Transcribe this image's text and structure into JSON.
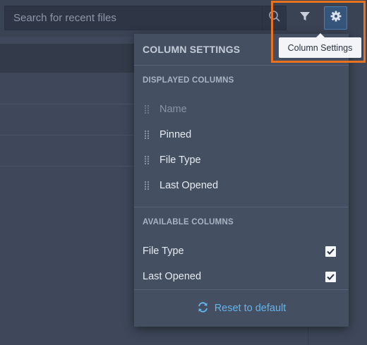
{
  "search": {
    "placeholder": "Search for recent files",
    "icon": "search-icon"
  },
  "toolbar": {
    "filter_icon": "filter-icon",
    "settings_icon": "gear-icon"
  },
  "tooltip": {
    "text": "Column Settings"
  },
  "panel": {
    "title": "COLUMN SETTINGS",
    "displayed_title": "DISPLAYED COLUMNS",
    "displayed_columns": [
      {
        "label": "Name",
        "enabled": false
      },
      {
        "label": "Pinned",
        "enabled": true
      },
      {
        "label": "File Type",
        "enabled": true
      },
      {
        "label": "Last Opened",
        "enabled": true
      }
    ],
    "available_title": "AVAILABLE COLUMNS",
    "available_columns": [
      {
        "label": "File Type",
        "checked": true
      },
      {
        "label": "Last Opened",
        "checked": true
      }
    ],
    "reset_label": "Reset to default"
  },
  "colors": {
    "accent": "#63b5ec",
    "highlight": "#e8721e",
    "panel": "#454f62",
    "background": "#3e485a"
  }
}
